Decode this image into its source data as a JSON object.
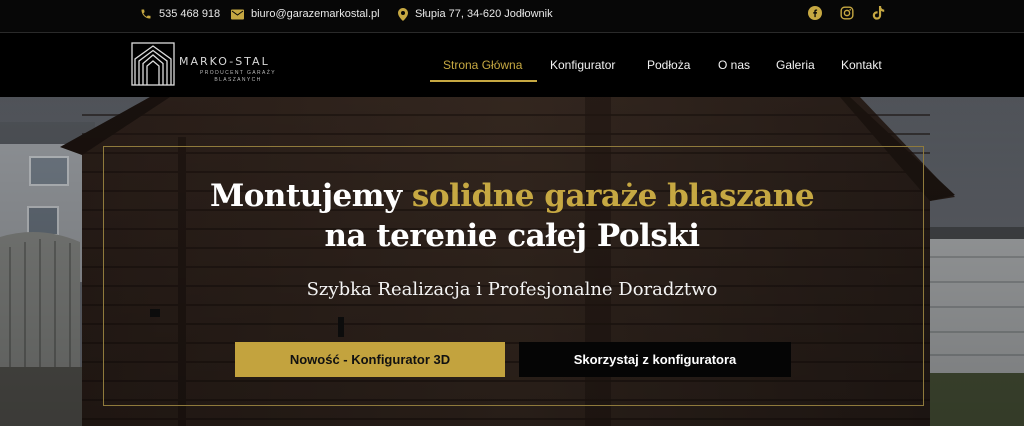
{
  "topbar": {
    "phone": "535 468 918",
    "email": "biuro@garazemarkostal.pl",
    "address": "Słupia 77, 34-620 Jodłownik",
    "social": [
      "facebook-icon",
      "instagram-icon",
      "tiktok-icon"
    ]
  },
  "brand": {
    "name": "MARKO-STAL",
    "tagline": "PRODUCENT GARAŻY BLASZANYCH"
  },
  "nav": {
    "items": [
      "Strona Główna",
      "Konfigurator",
      "Podłoża",
      "O nas",
      "Galeria",
      "Kontakt"
    ],
    "active": "Strona Główna"
  },
  "hero": {
    "headline_white": "Montujemy",
    "headline_gold": "solidne garaże blaszane",
    "headline_line2": "na terenie całej Polski",
    "subheadline": "Szybka Realizacja i Profesjonalne Doradztwo",
    "primary_button": "Nowość - Konfigurator 3D",
    "secondary_button": "Skorzystaj z konfiguratora"
  },
  "colors": {
    "accent_gold": "#c6a842",
    "topbar_bg": "#070707",
    "nav_bg": "#000000"
  }
}
